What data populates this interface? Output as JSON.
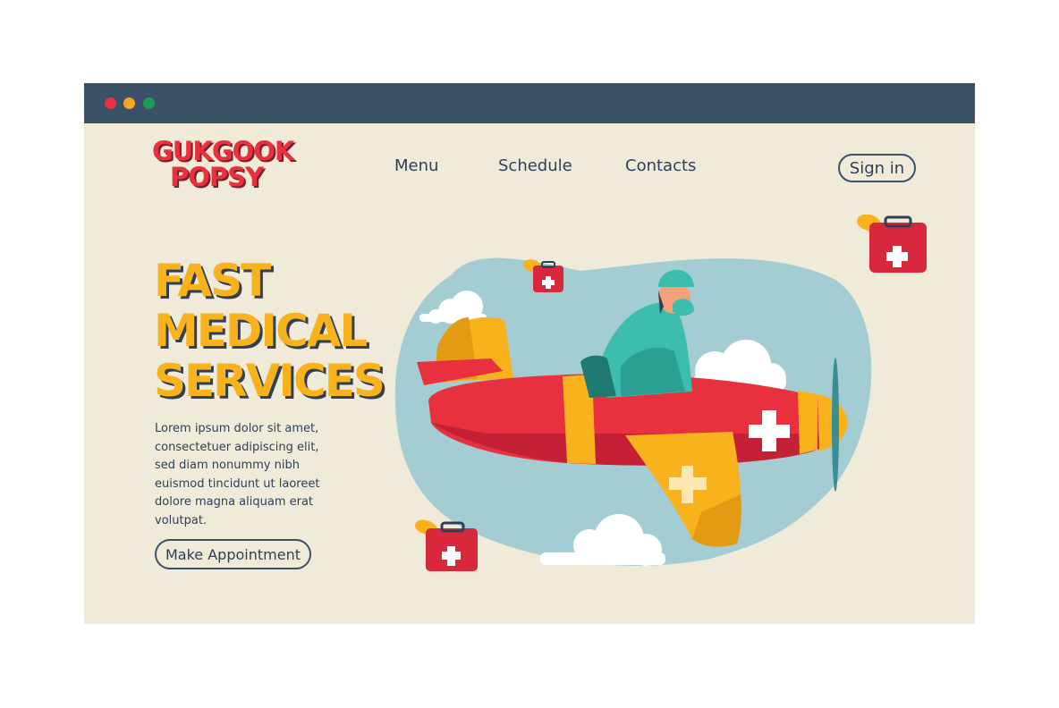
{
  "window": {
    "controls": [
      "close",
      "minimize",
      "maximize"
    ],
    "colors": {
      "titlebar": "#3b5168",
      "background": "#f0ead9"
    }
  },
  "brand": {
    "line1": "GUKGOOK",
    "line2": "POPSY"
  },
  "nav": {
    "menu": "Menu",
    "schedule": "Schedule",
    "contacts": "Contacts"
  },
  "auth": {
    "signin": "Sign in"
  },
  "hero": {
    "headline": [
      "FAST",
      "MEDICAL",
      "SERVICES"
    ],
    "description": "Lorem ipsum dolor sit amet, consectetuer adipiscing elit, sed diam nonummy nibh euismod tincidunt ut laoreet dolore magna aliquam erat volutpat.",
    "cta": "Make Appointment"
  },
  "illustration": {
    "subject": "pilot-flying-medical-airplane",
    "items": [
      "medical-airplane",
      "pilot",
      "first-aid-kit",
      "first-aid-kit",
      "first-aid-kit",
      "cloud",
      "cloud",
      "cloud"
    ]
  },
  "colors": {
    "accent": "#f7b21c",
    "brand_red": "#e8303f",
    "text": "#2f3f57",
    "sky": "#a3cdd2"
  }
}
